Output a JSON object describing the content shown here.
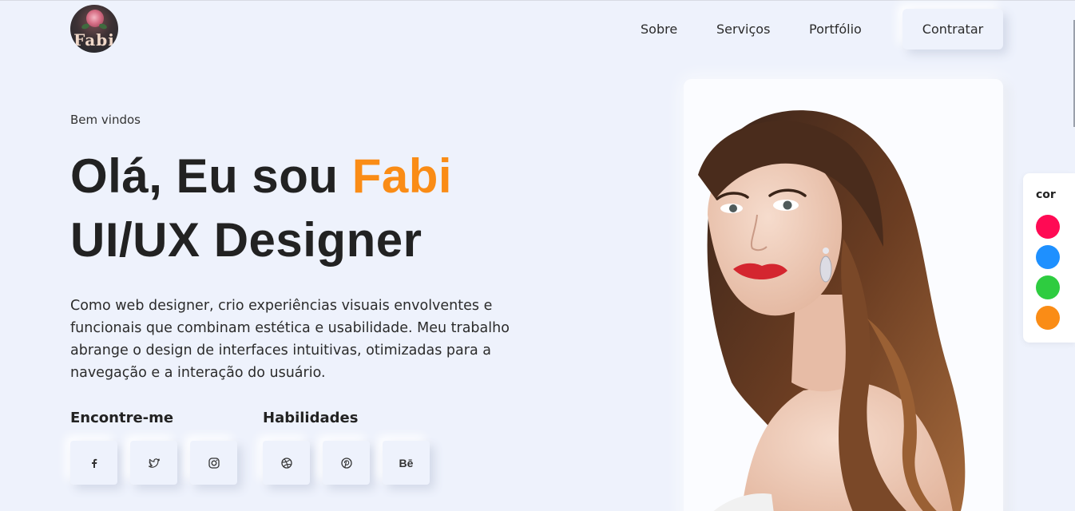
{
  "logo": {
    "text": "Fabi"
  },
  "nav": {
    "items": [
      "Sobre",
      "Serviços",
      "Portfólio"
    ],
    "cta_label": "Contratar"
  },
  "hero": {
    "welcome": "Bem vindos",
    "greeting": "Olá, Eu sou",
    "name": "Fabi",
    "role": "UI/UX Designer",
    "description": "Como web designer, crio experiências visuais envolventes e funcionais que combinam estética e usabilidade. Meu trabalho abrange o design de interfaces intuitivas, otimizadas para a navegação e a interação do usuário."
  },
  "social": {
    "title": "Encontre-me",
    "icons": [
      "facebook-icon",
      "twitter-icon",
      "instagram-icon"
    ]
  },
  "skills": {
    "title": "Habilidades",
    "icons": [
      "dribbble-icon",
      "pinterest-icon",
      "behance-icon"
    ],
    "behance_label": "Bē"
  },
  "color_picker": {
    "label": "cor",
    "colors": [
      "#ff0a54",
      "#1e90ff",
      "#2ecc40",
      "#fa8c16"
    ]
  },
  "colors": {
    "accent": "#fa8c16",
    "background": "#eef2fc"
  }
}
